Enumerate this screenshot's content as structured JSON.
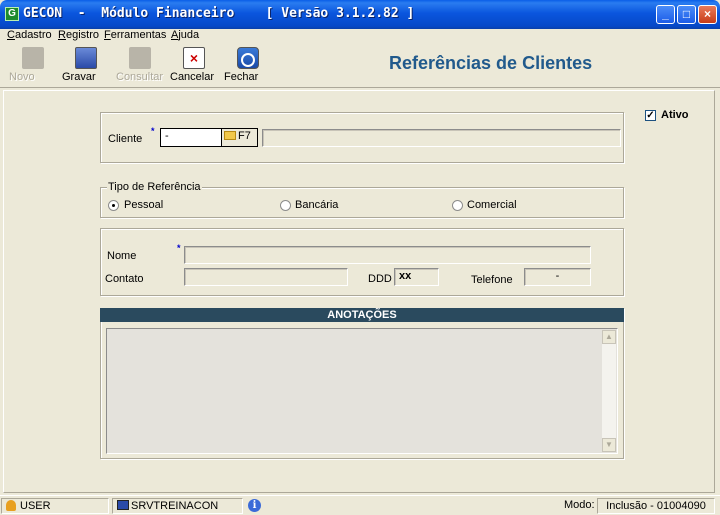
{
  "window": {
    "title": "GECON  -  Módulo Financeiro    [ Versão 3.1.2.82 ]",
    "app_icon": "G",
    "controls": [
      "minimize-icon",
      "maximize-icon",
      "close-icon"
    ]
  },
  "menu": [
    {
      "label": "Cadastro",
      "hotkey": "C",
      "rest": "adastro"
    },
    {
      "label": "Registro",
      "hotkey": "R",
      "rest": "egistro"
    },
    {
      "label": "Ferramentas",
      "hotkey": "F",
      "rest": "erramentas"
    },
    {
      "label": "Ajuda",
      "hotkey": "A",
      "rest": "juda"
    }
  ],
  "toolbar": {
    "buttons": [
      {
        "label": "Novo",
        "enabled": false,
        "icon": "new-icon"
      },
      {
        "label": "Gravar",
        "enabled": true,
        "icon": "save-icon"
      },
      {
        "label": "Consultar",
        "enabled": false,
        "icon": "search-icon"
      },
      {
        "label": "Cancelar",
        "enabled": true,
        "icon": "cancel-icon"
      },
      {
        "label": "Fechar",
        "enabled": true,
        "icon": "close-icon"
      }
    ],
    "page_title": "Referências de Clientes"
  },
  "form": {
    "ativo_label": "Ativo",
    "ativo_checked": true,
    "cliente_label": "Cliente",
    "required_mark": "*",
    "cliente_code": "-",
    "cliente_lookup_key": "F7",
    "cliente_name": "",
    "tipo_legend": "Tipo de Referência",
    "tipo_options": [
      {
        "label": "Pessoal",
        "selected": true
      },
      {
        "label": "Bancária",
        "selected": false
      },
      {
        "label": "Comercial",
        "selected": false
      }
    ],
    "nome_label": "Nome",
    "nome_value": "",
    "contato_label": "Contato",
    "contato_value": "",
    "ddd_label": "DDD",
    "ddd_value": "xx",
    "telefone_label": "Telefone",
    "telefone_value": "-",
    "notes_header": "ANOTAÇÕES",
    "notes_value": ""
  },
  "status": {
    "user": "USER",
    "server": "SRVTREINACON",
    "mode_label": "Modo:",
    "mode_value": "Inclusão - 01004090"
  },
  "colors": {
    "title_blue": "#215a8c",
    "notes_header_bg": "#2a4a5e",
    "required_mark": "#0000cc"
  }
}
